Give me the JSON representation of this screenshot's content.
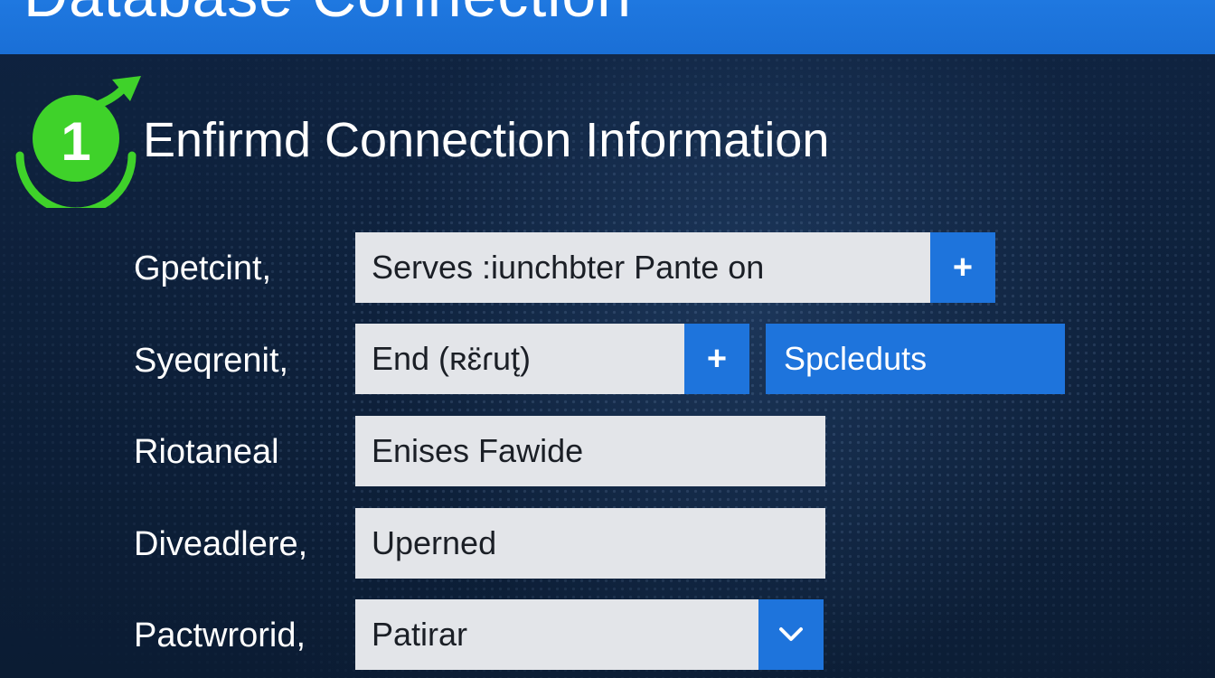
{
  "header": {
    "title": "Database Connection"
  },
  "step": {
    "number": "1",
    "title": "Enfirmd Connection Information",
    "accent_color": "#3fd22a"
  },
  "form": {
    "rows": [
      {
        "label": "Gpetcint,",
        "value": "Serves :iunchbter Pante on",
        "button": "+"
      },
      {
        "label": "Syeqrenit,",
        "value": "End (ʀɛ̈ɾut̨)",
        "button": "+",
        "secondary_button": "Spcleduts"
      },
      {
        "label": "Riotaneal",
        "value": "Enises Fawide"
      },
      {
        "label": "Diveadlere,",
        "value": "Uperned"
      },
      {
        "label": "Pactwrorid,",
        "value": "Patirar",
        "dropdown_icon": "chevron-down-icon"
      }
    ]
  },
  "colors": {
    "background": "#0f2340",
    "banner": "#1a6fd6",
    "button": "#1e74dc",
    "field": "#e3e5e9"
  }
}
